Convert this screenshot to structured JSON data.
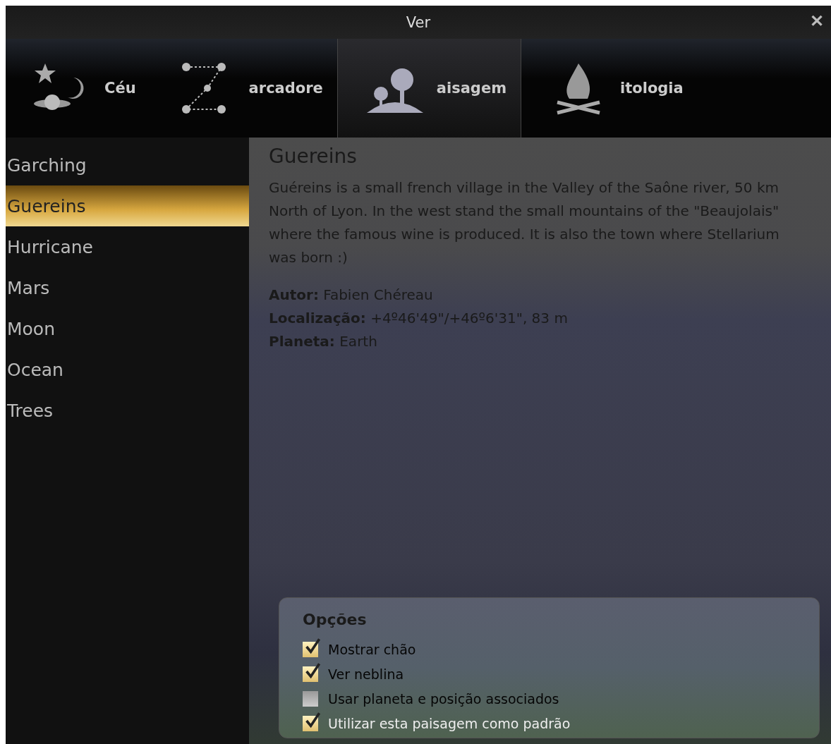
{
  "window": {
    "title": "Ver",
    "close": "✕"
  },
  "tabs": [
    {
      "label": "Céu",
      "kind": "sky",
      "selected": false
    },
    {
      "label": "arcadore",
      "kind": "markers",
      "selected": false
    },
    {
      "label": "aisagem",
      "kind": "landscape",
      "selected": true
    },
    {
      "label": "itologia",
      "kind": "fire",
      "selected": false
    }
  ],
  "landscapes": [
    {
      "label": "Garching",
      "selected": false
    },
    {
      "label": "Guereins",
      "selected": true
    },
    {
      "label": "Hurricane",
      "selected": false
    },
    {
      "label": "Mars",
      "selected": false
    },
    {
      "label": "Moon",
      "selected": false
    },
    {
      "label": "Ocean",
      "selected": false
    },
    {
      "label": "Trees",
      "selected": false
    }
  ],
  "detail": {
    "title": "Guereins",
    "description": "Guéreins is a small french village in the Valley of the Saône river, 50 km North of Lyon. In the west stand the small mountains of the \"Beaujolais\" where the famous wine is produced. It is also the town where Stellarium was born :)",
    "fields": [
      "**Autor:** Fabien Chéreau",
      "**Localização:** +4º46'49\"/+46º6'31\", 83 m",
      "**Planeta:** Earth"
    ]
  },
  "options": {
    "title": "Opções",
    "items": [
      {
        "label": "Mostrar chão",
        "checked": true,
        "highlighted": false
      },
      {
        "label": "Ver neblina",
        "checked": true,
        "highlighted": false
      },
      {
        "label": "Usar planeta e posição associados",
        "checked": false,
        "highlighted": false
      },
      {
        "label": "Utilizar esta paisagem como padrão",
        "checked": true,
        "highlighted": true
      }
    ]
  }
}
